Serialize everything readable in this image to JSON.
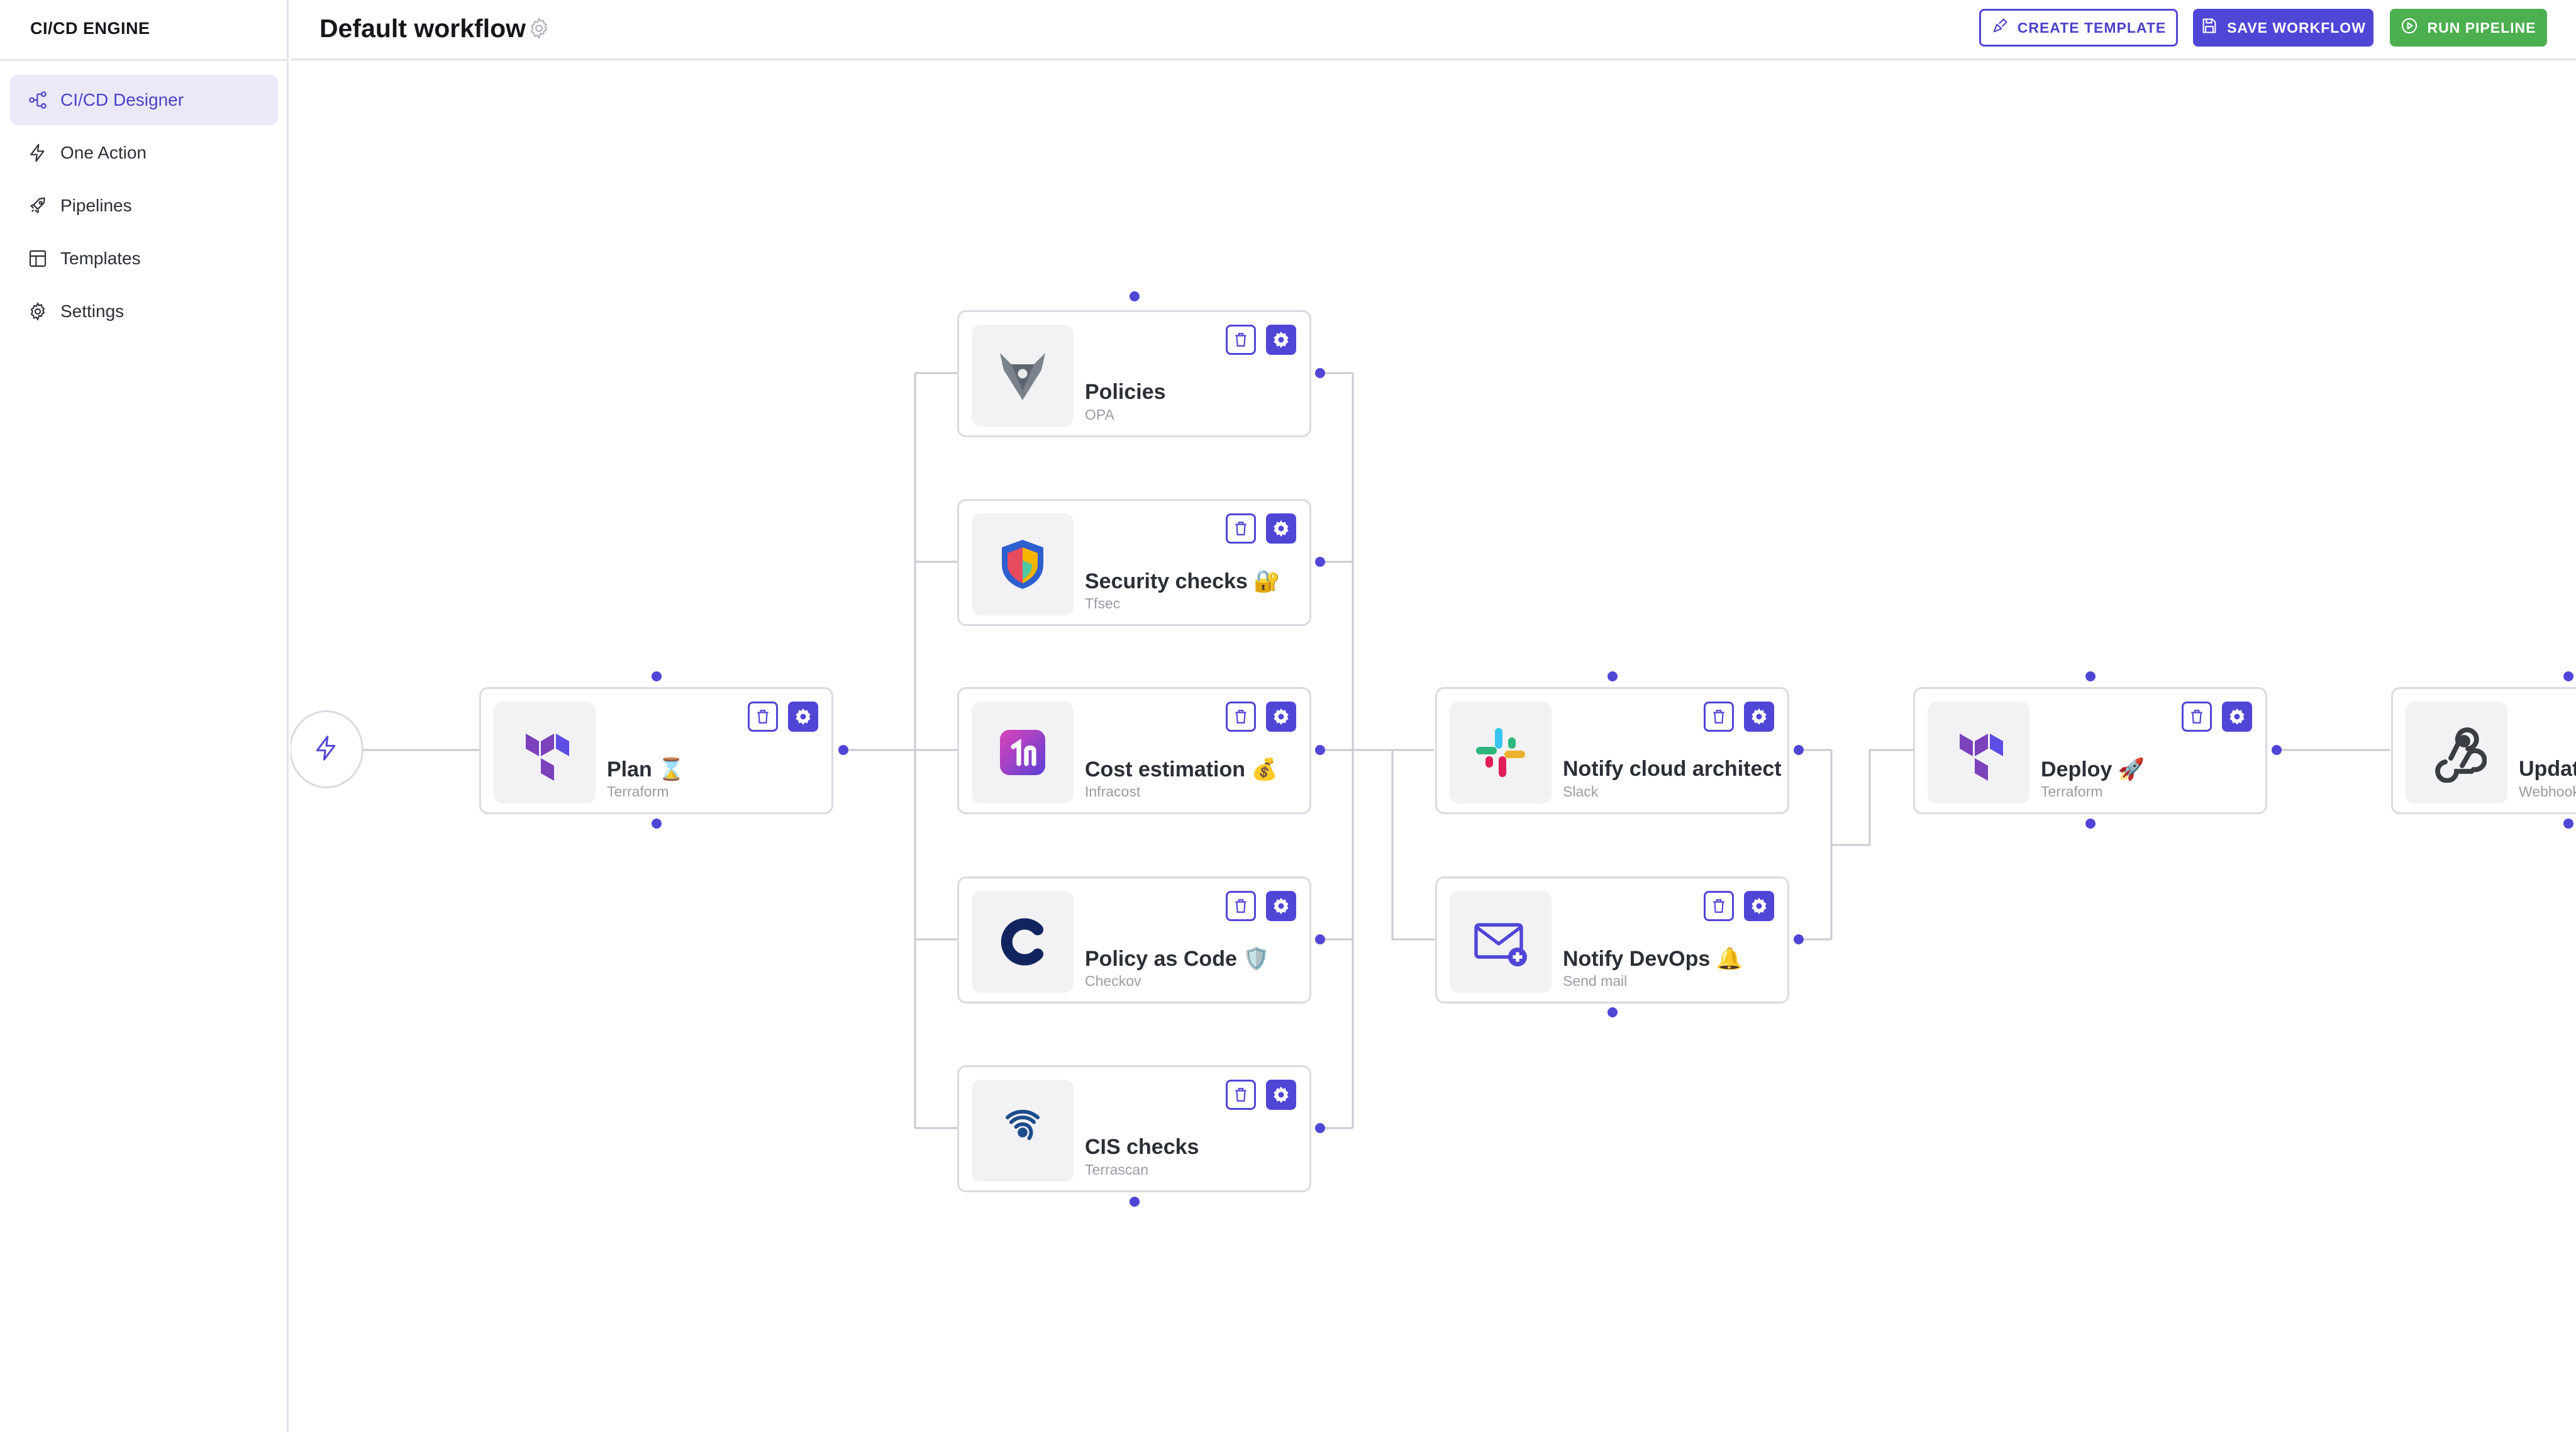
{
  "app": {
    "brand": "CI/CD ENGINE"
  },
  "sidebar": {
    "items": [
      {
        "label": "CI/CD Designer",
        "icon": "workflow-icon",
        "active": true
      },
      {
        "label": "One Action",
        "icon": "bolt-icon",
        "active": false
      },
      {
        "label": "Pipelines",
        "icon": "rocket-icon",
        "active": false
      },
      {
        "label": "Templates",
        "icon": "layout-icon",
        "active": false
      },
      {
        "label": "Settings",
        "icon": "gear-icon",
        "active": false
      }
    ]
  },
  "header": {
    "title": "Default workflow",
    "buttons": {
      "create_template": "CREATE TEMPLATE",
      "save_workflow": "SAVE WORKFLOW",
      "run_pipeline": "RUN PIPELINE"
    }
  },
  "colors": {
    "accent": "#5046d6",
    "success": "#4caf50",
    "edge": "#c9cad2",
    "nav_active_bg": "#ebe9f7"
  },
  "canvas": {
    "trigger": {
      "icon": "bolt-icon"
    },
    "nodes": [
      {
        "title": "Plan ⌛",
        "subtitle": "Terraform",
        "icon": "terraform-icon"
      },
      {
        "title": "Policies",
        "subtitle": "OPA",
        "icon": "opa-icon"
      },
      {
        "title": "Security checks 🔐",
        "subtitle": "Tfsec",
        "icon": "tfsec-shield-icon"
      },
      {
        "title": "Cost estimation 💰",
        "subtitle": "Infracost",
        "icon": "infracost-icon"
      },
      {
        "title": "Policy as Code 🛡️",
        "subtitle": "Checkov",
        "icon": "checkov-icon"
      },
      {
        "title": "CIS checks",
        "subtitle": "Terrascan",
        "icon": "terrascan-icon"
      },
      {
        "title": "Notify cloud architect",
        "subtitle": "Slack",
        "icon": "slack-icon"
      },
      {
        "title": "Notify DevOps 🔔",
        "subtitle": "Send mail",
        "icon": "mail-icon"
      },
      {
        "title": "Deploy 🚀",
        "subtitle": "Terraform",
        "icon": "terraform-icon"
      },
      {
        "title": "Update",
        "subtitle": "Webhook",
        "icon": "webhook-icon"
      }
    ]
  }
}
